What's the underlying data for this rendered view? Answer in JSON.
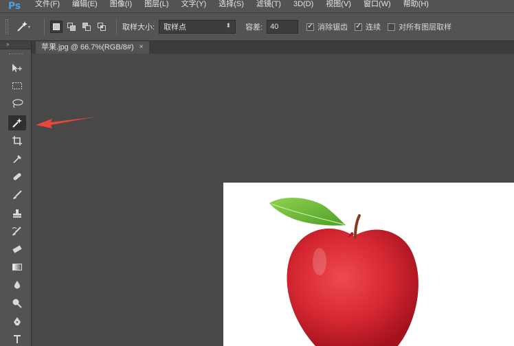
{
  "menubar": {
    "logo": "Ps",
    "items": [
      "文件(F)",
      "编辑(E)",
      "图像(I)",
      "图层(L)",
      "文字(Y)",
      "选择(S)",
      "滤镜(T)",
      "3D(D)",
      "视图(V)",
      "窗口(W)",
      "帮助(H)"
    ]
  },
  "options": {
    "tool_icon": "magic-wand-icon",
    "sample_size_label": "取样大小:",
    "sample_size_value": "取样点",
    "tolerance_label": "容差:",
    "tolerance_value": "40",
    "antialias_label": "消除锯齿",
    "antialias_checked": true,
    "contiguous_label": "连续",
    "contiguous_checked": true,
    "all_layers_label": "对所有图层取样",
    "all_layers_checked": false
  },
  "toolbar": {
    "collapse_label": "»",
    "tools": [
      "move-tool",
      "rect-marquee-tool",
      "lasso-tool",
      "magic-wand-tool",
      "crop-tool",
      "eyedropper-tool",
      "healing-brush-tool",
      "brush-tool",
      "clone-stamp-tool",
      "history-brush-tool",
      "eraser-tool",
      "gradient-tool",
      "blur-tool",
      "dodge-tool",
      "pen-tool",
      "type-tool"
    ],
    "active_tool": "magic-wand-tool"
  },
  "document": {
    "tab_title": "苹果.jpg @ 66.7%(RGB/8#)",
    "close_glyph": "×"
  },
  "colors": {
    "accent_logo": "#4aa0e6",
    "annotation_arrow": "#e8453c",
    "apple_red": "#d62832",
    "leaf_green": "#6fbf3a"
  }
}
